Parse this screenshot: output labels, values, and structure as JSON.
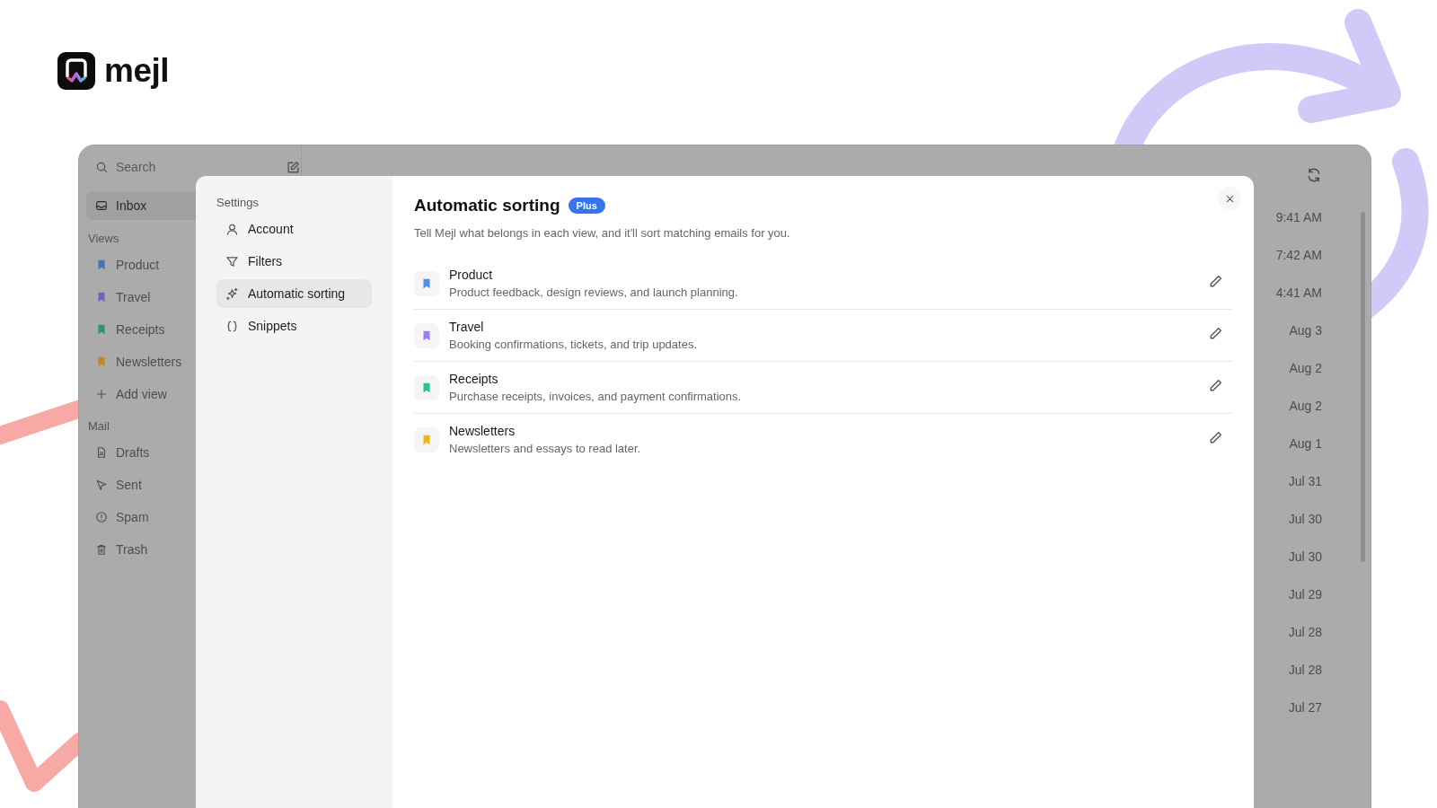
{
  "logo": {
    "name": "mejl"
  },
  "sidebar": {
    "search": {
      "placeholder": "Search"
    },
    "items": [
      {
        "label": "Inbox",
        "kind": "inbox",
        "selected": true
      }
    ],
    "sections": [
      {
        "title": "Views",
        "items": [
          {
            "label": "Product",
            "kind": "view",
            "color": "#4673b8"
          },
          {
            "label": "Travel",
            "kind": "view",
            "color": "#7560bd"
          },
          {
            "label": "Receipts",
            "kind": "view",
            "color": "#2d9566"
          },
          {
            "label": "Newsletters",
            "kind": "view",
            "color": "#bf8a22"
          },
          {
            "label": "Add view",
            "kind": "add"
          }
        ]
      },
      {
        "title": "Mail",
        "items": [
          {
            "label": "Drafts",
            "kind": "drafts"
          },
          {
            "label": "Sent",
            "kind": "sent"
          },
          {
            "label": "Spam",
            "kind": "spam"
          },
          {
            "label": "Trash",
            "kind": "trash"
          }
        ]
      }
    ]
  },
  "message_times": [
    "9:41 AM",
    "7:42 AM",
    "4:41 AM",
    "Aug 3",
    "Aug 2",
    "Aug 2",
    "Aug 1",
    "Jul 31",
    "Jul 30",
    "Jul 30",
    "Jul 29",
    "Jul 28",
    "Jul 28",
    "Jul 27"
  ],
  "settings": {
    "title": "Settings",
    "nav": [
      {
        "label": "Account",
        "kind": "account",
        "selected": false
      },
      {
        "label": "Filters",
        "kind": "filters",
        "selected": false
      },
      {
        "label": "Automatic sorting",
        "kind": "sparkle",
        "selected": true
      },
      {
        "label": "Snippets",
        "kind": "snippets",
        "selected": false
      }
    ]
  },
  "panel": {
    "title": "Automatic sorting",
    "badge": "Plus",
    "description": "Tell Mejl what belongs in each view, and it'll sort matching emails for you.",
    "views": [
      {
        "name": "Product",
        "description": "Product feedback, design reviews, and launch planning.",
        "color": "#4d8ef7"
      },
      {
        "name": "Travel",
        "description": "Booking confirmations, tickets, and trip updates.",
        "color": "#9b7cf5"
      },
      {
        "name": "Receipts",
        "description": "Purchase receipts, invoices, and payment confirmations.",
        "color": "#22c88a"
      },
      {
        "name": "Newsletters",
        "description": "Newsletters and essays to read later.",
        "color": "#f5b316"
      }
    ]
  }
}
